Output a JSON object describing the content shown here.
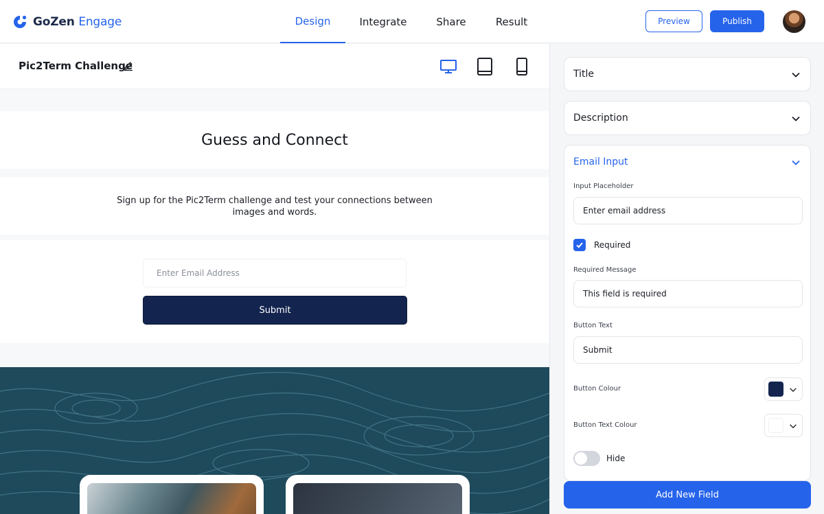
{
  "header": {
    "logo_text_main": "GoZen",
    "logo_text_accent": "Engage",
    "tabs": [
      {
        "label": "Design",
        "active": true
      },
      {
        "label": "Integrate",
        "active": false
      },
      {
        "label": "Share",
        "active": false
      },
      {
        "label": "Result",
        "active": false
      }
    ],
    "preview_label": "Preview",
    "publish_label": "Publish",
    "accent_color": "#2563eb"
  },
  "canvas": {
    "project_title": "Pic2Term Challenge",
    "device_icons": [
      "desktop-icon",
      "tablet-icon",
      "mobile-icon"
    ],
    "active_device": "desktop-icon",
    "form_title": "Guess and Connect",
    "form_description": "Sign up for the Pic2Term challenge and test your connections between images and words.",
    "email_placeholder": "Enter Email Address",
    "submit_label": "Submit",
    "submit_color": "#13244f"
  },
  "panel": {
    "sections": [
      {
        "label": "Title",
        "expanded": false
      },
      {
        "label": "Description",
        "expanded": false
      },
      {
        "label": "Email Input",
        "expanded": true
      }
    ],
    "email_input": {
      "placeholder_label": "Input Placeholder",
      "placeholder_value": "Enter email address",
      "required_label": "Required",
      "required_checked": true,
      "required_message_label": "Required Message",
      "required_message_value": "This field is required",
      "button_text_label": "Button Text",
      "button_text_value": "Submit",
      "button_colour_label": "Button Colour",
      "button_colour_value": "#13244f",
      "button_text_colour_label": "Button Text Colour",
      "button_text_colour_value": "#ffffff",
      "hide_label": "Hide",
      "hide_on": false
    },
    "add_field_label": "Add New Field"
  }
}
